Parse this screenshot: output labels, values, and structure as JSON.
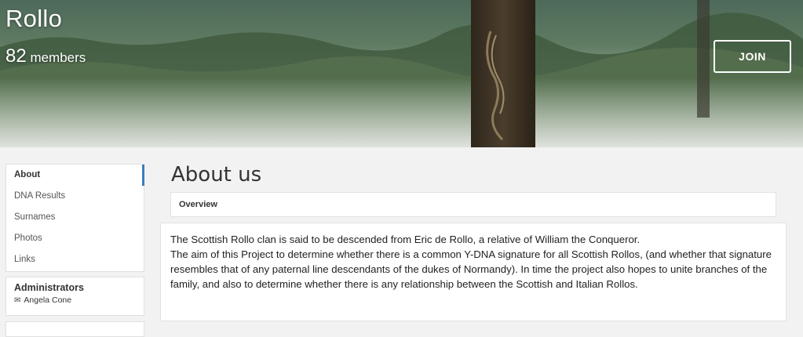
{
  "group": {
    "name": "Rollo",
    "member_count": "82",
    "member_suffix": "members",
    "join_label": "JOIN"
  },
  "sidebar": {
    "items": [
      {
        "label": "About",
        "active": true
      },
      {
        "label": "DNA Results"
      },
      {
        "label": "Surnames"
      },
      {
        "label": "Photos"
      },
      {
        "label": "Links"
      }
    ],
    "administrators_title": "Administrators",
    "admin_icon": "mail-icon",
    "admins": [
      "Angela Cone"
    ]
  },
  "main": {
    "heading": "About us",
    "section_title": "Overview",
    "paragraphs": [
      "The Scottish Rollo clan is said to be descended from Eric de Rollo, a relative of William the Conqueror.",
      "The aim of this Project to determine whether there is a common Y-DNA signature for all Scottish Rollos, (and whether that signature resembles that of any paternal line descendants of the dukes of Normandy).  In time the project also hopes to unite branches of the family, and also to determine whether there is any relationship between the Scottish and Italian Rollos."
    ]
  },
  "colors": {
    "accent": "#3b7bbf",
    "background": "#f2f2f2"
  }
}
